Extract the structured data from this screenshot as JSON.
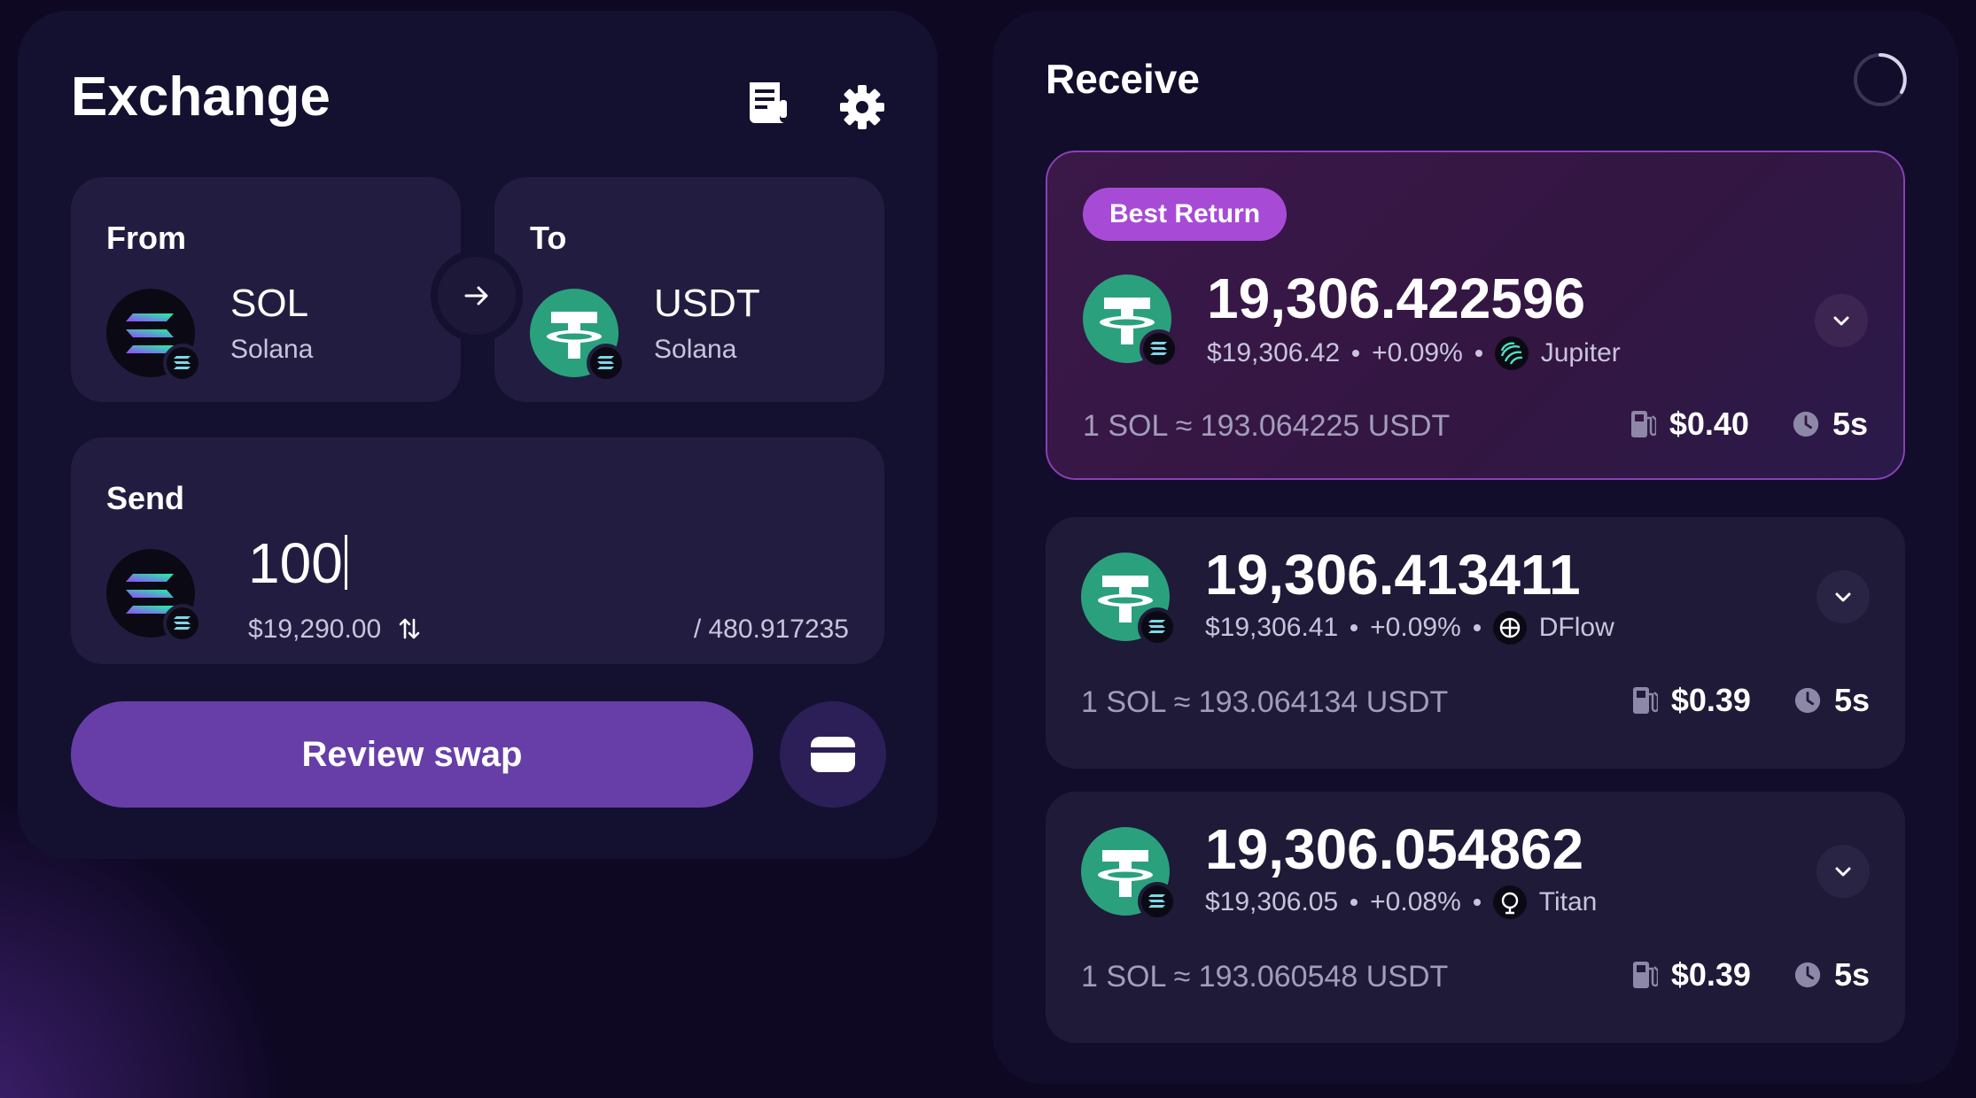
{
  "exchange": {
    "title": "Exchange",
    "from": {
      "label": "From",
      "symbol": "SOL",
      "chain": "Solana"
    },
    "to": {
      "label": "To",
      "symbol": "USDT",
      "chain": "Solana"
    },
    "send": {
      "label": "Send",
      "amount": "100",
      "usd_value": "$19,290.00",
      "balance": "/ 480.917235"
    },
    "review_label": "Review swap"
  },
  "receive": {
    "title": "Receive",
    "quotes": [
      {
        "badge": "Best Return",
        "amount": "19,306.422596",
        "usd": "$19,306.42",
        "change": "+0.09%",
        "provider": "Jupiter",
        "rate": "1 SOL ≈ 193.064225 USDT",
        "fee": "$0.40",
        "time": "5s"
      },
      {
        "amount": "19,306.413411",
        "usd": "$19,306.41",
        "change": "+0.09%",
        "provider": "DFlow",
        "rate": "1 SOL ≈ 193.064134 USDT",
        "fee": "$0.39",
        "time": "5s"
      },
      {
        "amount": "19,306.054862",
        "usd": "$19,306.05",
        "change": "+0.08%",
        "provider": "Titan",
        "rate": "1 SOL ≈ 193.060548 USDT",
        "fee": "$0.39",
        "time": "5s"
      }
    ]
  },
  "colors": {
    "background": "#0e0823",
    "accent_purple": "#673ea8",
    "best_badge": "#a74bd6",
    "usdt_green": "#2aa17c"
  },
  "icons": [
    "receipt-icon",
    "gear-icon",
    "arrow-right-icon",
    "swap-vertical-icon",
    "wallet-icon",
    "spinner-icon",
    "gas-pump-icon",
    "clock-icon",
    "chevron-down-icon"
  ]
}
